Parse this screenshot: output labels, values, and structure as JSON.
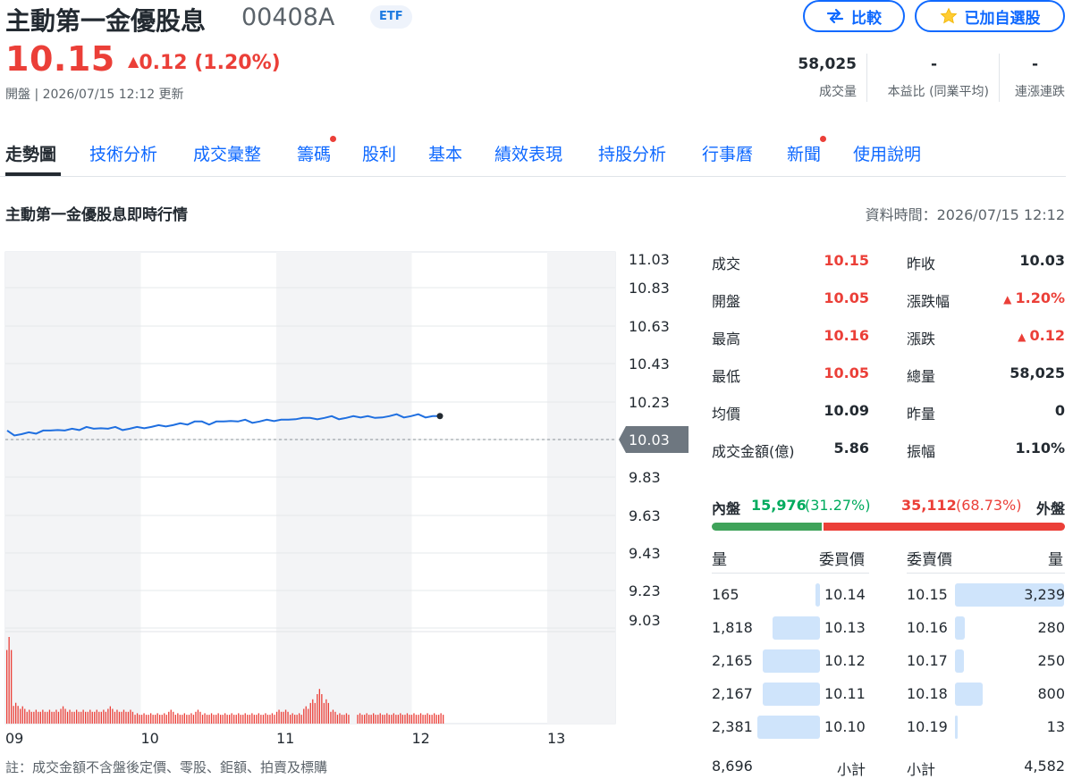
{
  "header": {
    "name": "主動第一金優股息",
    "code": "00408A",
    "badge": "ETF",
    "compare_label": "比較",
    "watchlist_label": "已加自選股",
    "price": "10.15",
    "change": "0.12 (1.20%)",
    "status": "開盤 | 2026/07/15 12:12 更新",
    "stats": [
      {
        "value": "58,025",
        "label": "成交量"
      },
      {
        "value": "-",
        "label": "本益比 (同業平均)"
      },
      {
        "value": "-",
        "label": "連漲連跌"
      }
    ]
  },
  "tabs": [
    {
      "label": "走勢圖",
      "active": true
    },
    {
      "label": "技術分析"
    },
    {
      "label": "成交彙整"
    },
    {
      "label": "籌碼",
      "dot": true
    },
    {
      "label": "股利"
    },
    {
      "label": "基本"
    },
    {
      "label": "績效表現"
    },
    {
      "label": "持股分析"
    },
    {
      "label": "行事曆"
    },
    {
      "label": "新聞",
      "dot": true
    },
    {
      "label": "使用說明"
    }
  ],
  "section": {
    "title": "主動第一金優股息即時行情",
    "data_time": "資料時間：2026/07/15 12:12"
  },
  "chart_data": {
    "type": "line",
    "y_ticks": [
      "11.03",
      "10.83",
      "10.63",
      "10.43",
      "10.23",
      "10.03",
      "9.83",
      "9.63",
      "9.43",
      "9.23",
      "9.03"
    ],
    "x_ticks": [
      "09",
      "10",
      "11",
      "12",
      "13"
    ],
    "ylim": [
      9.03,
      11.03
    ],
    "previous_close": 10.03,
    "previous_close_label": "10.03",
    "price_series": [
      10.07,
      10.05,
      10.05,
      10.06,
      10.06,
      10.07,
      10.07,
      10.08,
      10.07,
      10.08,
      10.08,
      10.09,
      10.08,
      10.09,
      10.08,
      10.09,
      10.08,
      10.08,
      10.09,
      10.09,
      10.09,
      10.1,
      10.1,
      10.1,
      10.11,
      10.11,
      10.12,
      10.12,
      10.11,
      10.12,
      10.12,
      10.13,
      10.12,
      10.13,
      10.12,
      10.12,
      10.13,
      10.13,
      10.13,
      10.13,
      10.14,
      10.14,
      10.14,
      10.14,
      10.14,
      10.15,
      10.14,
      10.14,
      10.15,
      10.15,
      10.15,
      10.14,
      10.15,
      10.15,
      10.16,
      10.15,
      10.15,
      10.16,
      10.15,
      10.15,
      10.15
    ],
    "volume_series": [
      25,
      6,
      5,
      4,
      4,
      4,
      4,
      4,
      5,
      4,
      4,
      4,
      4,
      4,
      4,
      5,
      4,
      4,
      4,
      3,
      3,
      3,
      3,
      3,
      4,
      3,
      3,
      3,
      4,
      3,
      3,
      3,
      3,
      3,
      3,
      3,
      3,
      3,
      3,
      3,
      4,
      4,
      3,
      3,
      5,
      7,
      10,
      7,
      4,
      3,
      3,
      0,
      3,
      3,
      3,
      3,
      3,
      3,
      3,
      3,
      3,
      3,
      3,
      3,
      3
    ],
    "volume_max": 25
  },
  "footnote": "註：成交金額不含盤後定價、零股、鉅額、拍賣及標購",
  "quote": {
    "left": [
      {
        "label": "成交",
        "value": "10.15",
        "color": "red"
      },
      {
        "label": "開盤",
        "value": "10.05",
        "color": "red"
      },
      {
        "label": "最高",
        "value": "10.16",
        "color": "red"
      },
      {
        "label": "最低",
        "value": "10.05",
        "color": "red"
      },
      {
        "label": "均價",
        "value": "10.09",
        "color": "dark"
      },
      {
        "label": "成交金額(億)",
        "value": "5.86",
        "color": "dark"
      }
    ],
    "right": [
      {
        "label": "昨收",
        "value": "10.03",
        "color": "dark"
      },
      {
        "label": "漲跌幅",
        "value": "1.20%",
        "color": "red",
        "arrow": true
      },
      {
        "label": "漲跌",
        "value": "0.12",
        "color": "red",
        "arrow": true
      },
      {
        "label": "總量",
        "value": "58,025",
        "color": "dark"
      },
      {
        "label": "昨量",
        "value": "0",
        "color": "dark"
      },
      {
        "label": "振幅",
        "value": "1.10%",
        "color": "dark"
      }
    ]
  },
  "inout": {
    "in_label": "內盤",
    "in_value": "15,976",
    "in_pct": "(31.27%)",
    "out_value": "35,112",
    "out_pct": "(68.73%)",
    "out_label": "外盤",
    "in_fraction": 0.3127
  },
  "orderbook": {
    "bid_qty_header": "量",
    "bid_price_header": "委買價",
    "ask_price_header": "委賣價",
    "ask_qty_header": "量",
    "bids": [
      {
        "qty": "165",
        "price": "10.14",
        "level": 0.07
      },
      {
        "qty": "1,818",
        "price": "10.13",
        "level": 0.76
      },
      {
        "qty": "2,165",
        "price": "10.12",
        "level": 0.91
      },
      {
        "qty": "2,167",
        "price": "10.11",
        "level": 0.91
      },
      {
        "qty": "2,381",
        "price": "10.10",
        "level": 1.0
      }
    ],
    "asks": [
      {
        "price": "10.15",
        "qty": "3,239",
        "level": 1.0
      },
      {
        "price": "10.16",
        "qty": "280",
        "level": 0.09
      },
      {
        "price": "10.17",
        "qty": "250",
        "level": 0.08
      },
      {
        "price": "10.18",
        "qty": "800",
        "level": 0.25
      },
      {
        "price": "10.19",
        "qty": "13",
        "level": 0.01
      }
    ],
    "bid_total": "8,696",
    "subtotal_label": "小計",
    "ask_total": "4,582"
  }
}
